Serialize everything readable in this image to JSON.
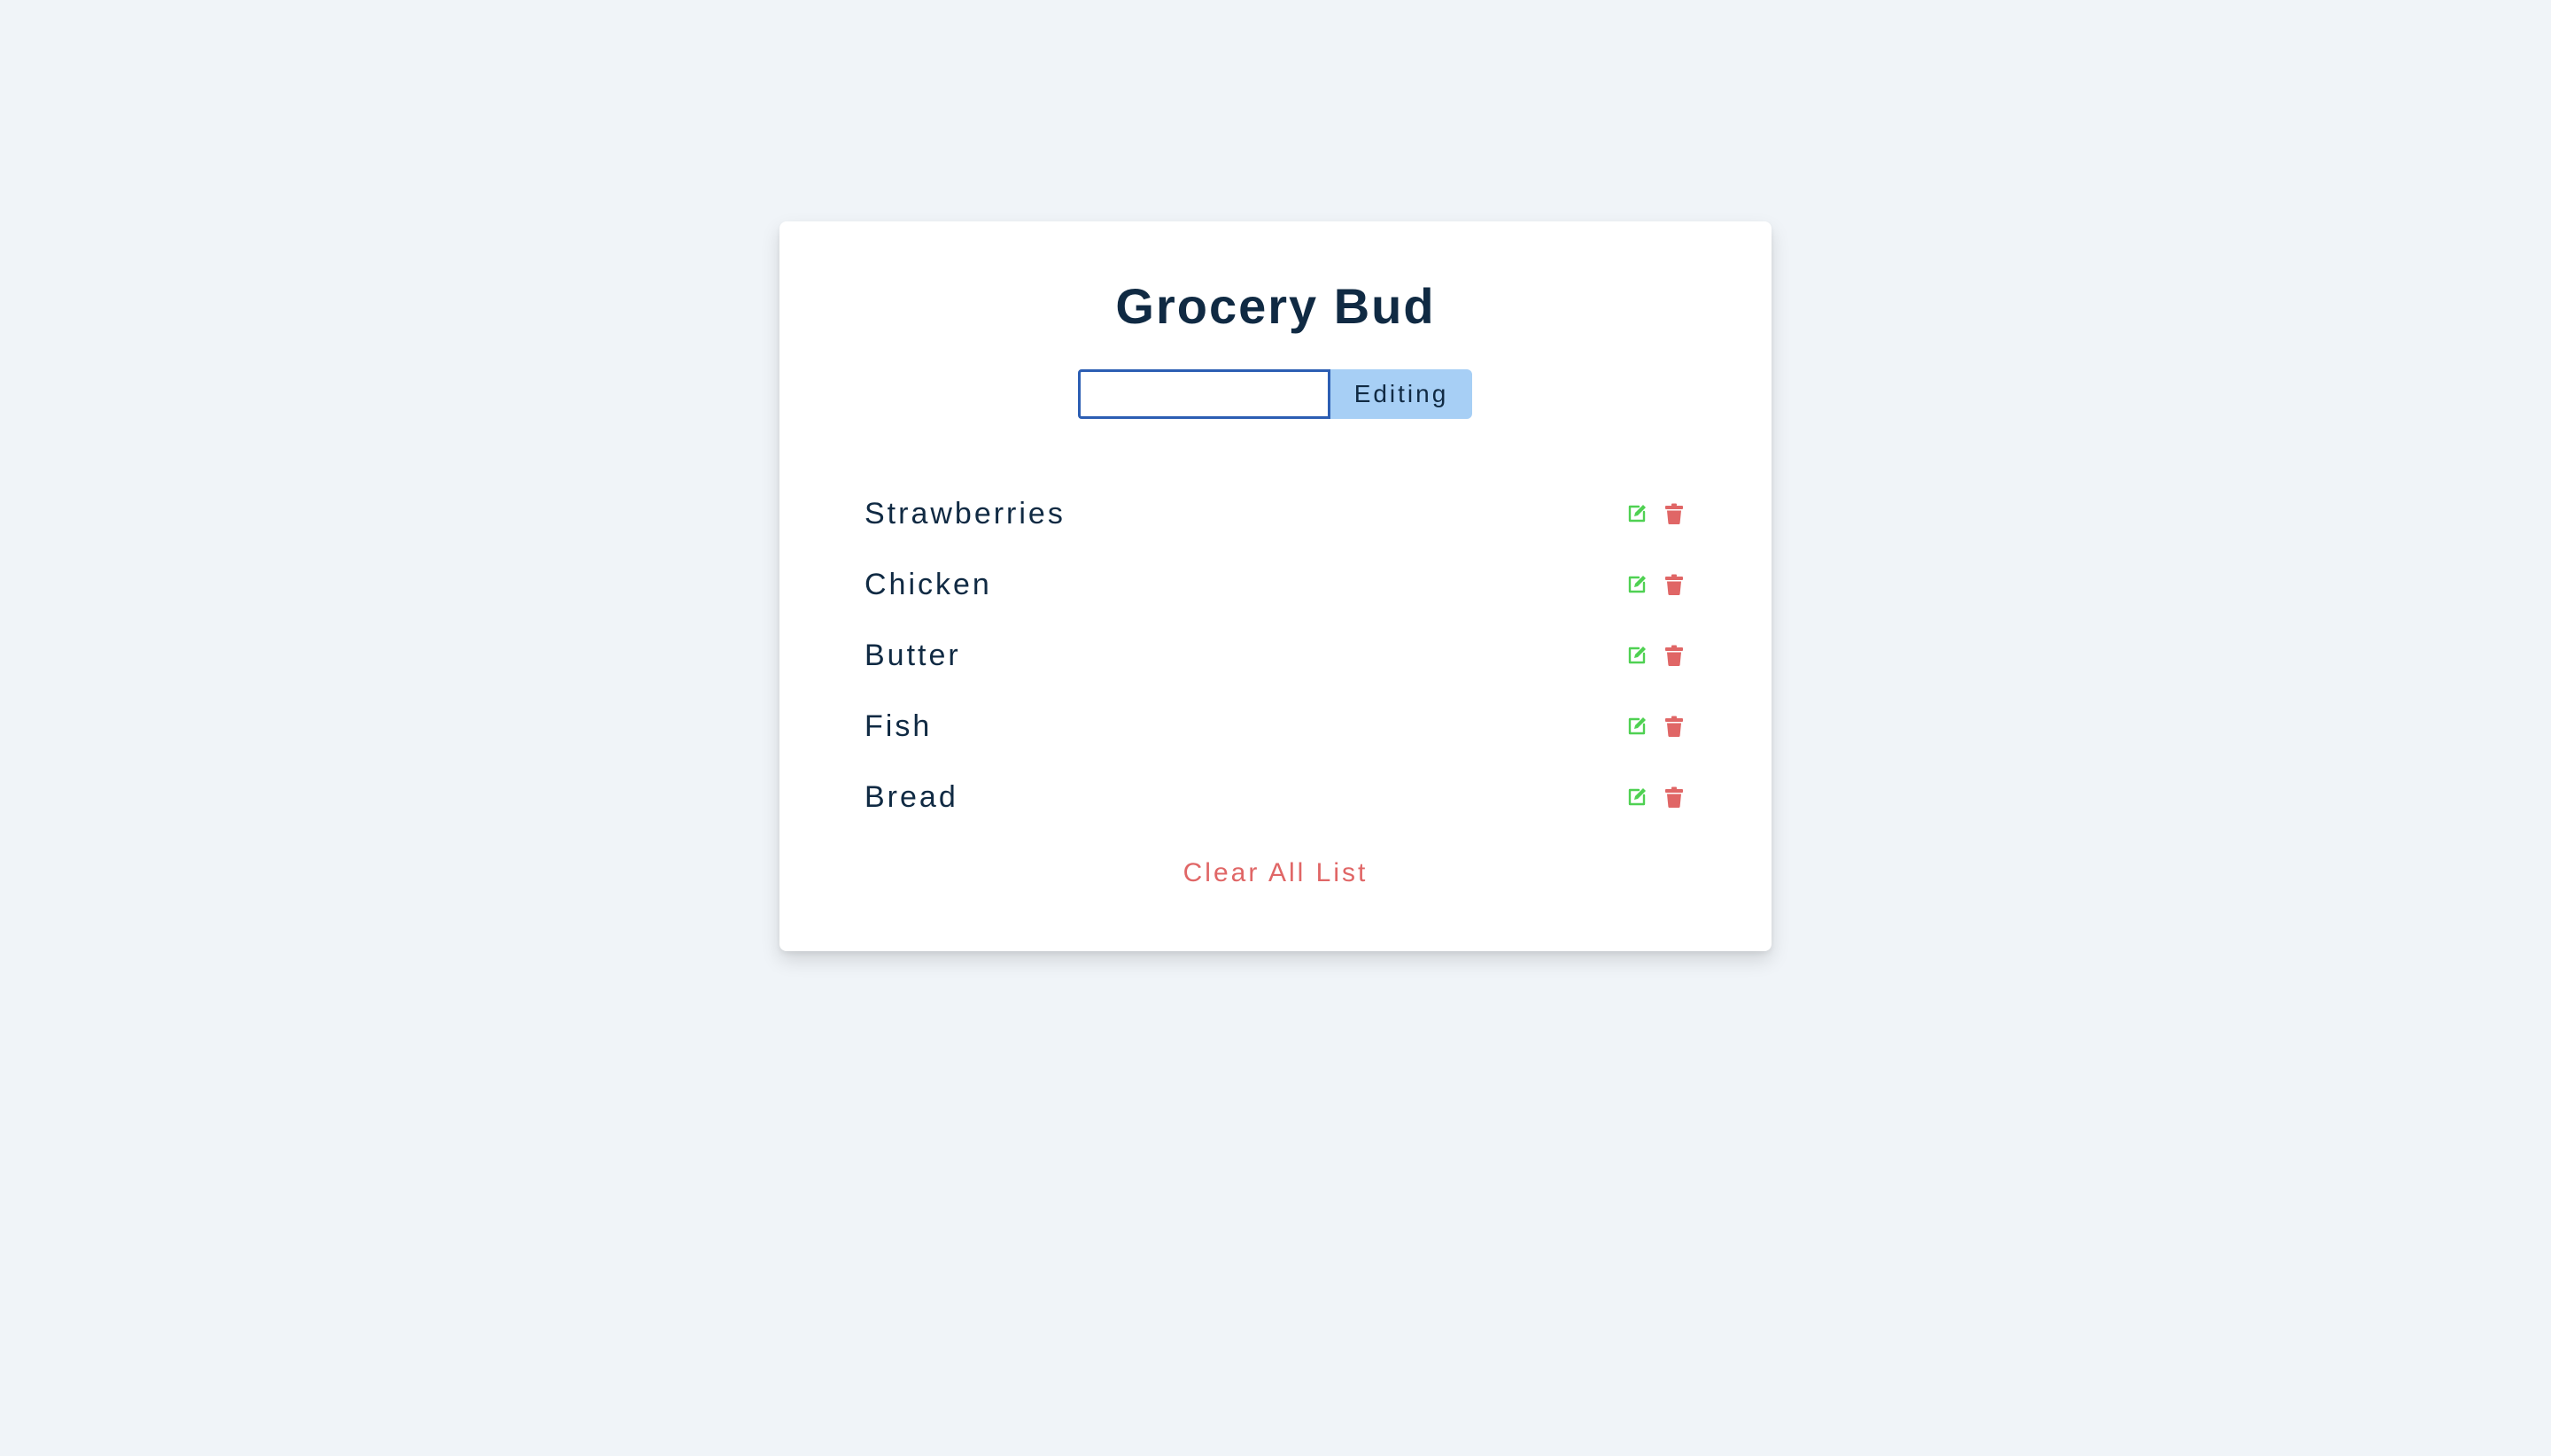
{
  "app": {
    "title": "Grocery Bud"
  },
  "form": {
    "input_value": "",
    "input_placeholder": "",
    "submit_label": "Editing"
  },
  "items": [
    {
      "name": "Strawberries",
      "edit_icon": "edit-icon",
      "delete_icon": "trash-icon"
    },
    {
      "name": "Chicken",
      "edit_icon": "edit-icon",
      "delete_icon": "trash-icon"
    },
    {
      "name": "Butter",
      "edit_icon": "edit-icon",
      "delete_icon": "trash-icon"
    },
    {
      "name": "Fish",
      "edit_icon": "edit-icon",
      "delete_icon": "trash-icon"
    },
    {
      "name": "Bread",
      "edit_icon": "edit-icon",
      "delete_icon": "trash-icon"
    }
  ],
  "clear_button": {
    "label": "Clear All List"
  },
  "colors": {
    "background": "#f0f4f8",
    "card": "#ffffff",
    "title": "#102a43",
    "input_border": "#2c5eb3",
    "submit_bg": "#a7cff5",
    "edit_icon": "#4fd152",
    "delete_icon": "#e06666",
    "clear_text": "#e06666"
  }
}
